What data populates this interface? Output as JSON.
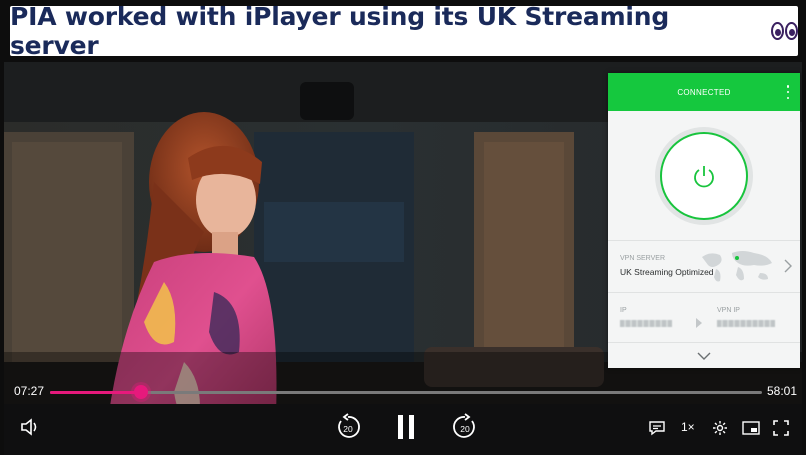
{
  "caption": {
    "text": "PIA worked with iPlayer using its UK Streaming server"
  },
  "player": {
    "current_time": "07:27",
    "total_time": "58:01",
    "progress": 0.128,
    "skip_back_seconds": "20",
    "skip_forward_seconds": "20",
    "speed": "1×",
    "accent_color": "#e6197c"
  },
  "vpn": {
    "status": "CONNECTED",
    "status_color": "#15c83e",
    "server_label": "VPN SERVER",
    "server_name": "UK Streaming Optimized",
    "ip_label": "IP",
    "vpn_ip_label": "VPN IP"
  },
  "icons": {
    "volume": "volume-icon",
    "skip_back": "replay-20-icon",
    "pause": "pause-icon",
    "skip_forward": "forward-20-icon",
    "subtitles": "subtitles-icon",
    "settings": "gear-icon",
    "pip": "picture-in-picture-icon",
    "fullscreen": "fullscreen-icon",
    "power": "power-icon",
    "menu": "kebab-menu-icon",
    "chevron_right": "chevron-right-icon",
    "chevron_down": "chevron-down-icon",
    "eyes": "eyes-emoji-icon"
  }
}
